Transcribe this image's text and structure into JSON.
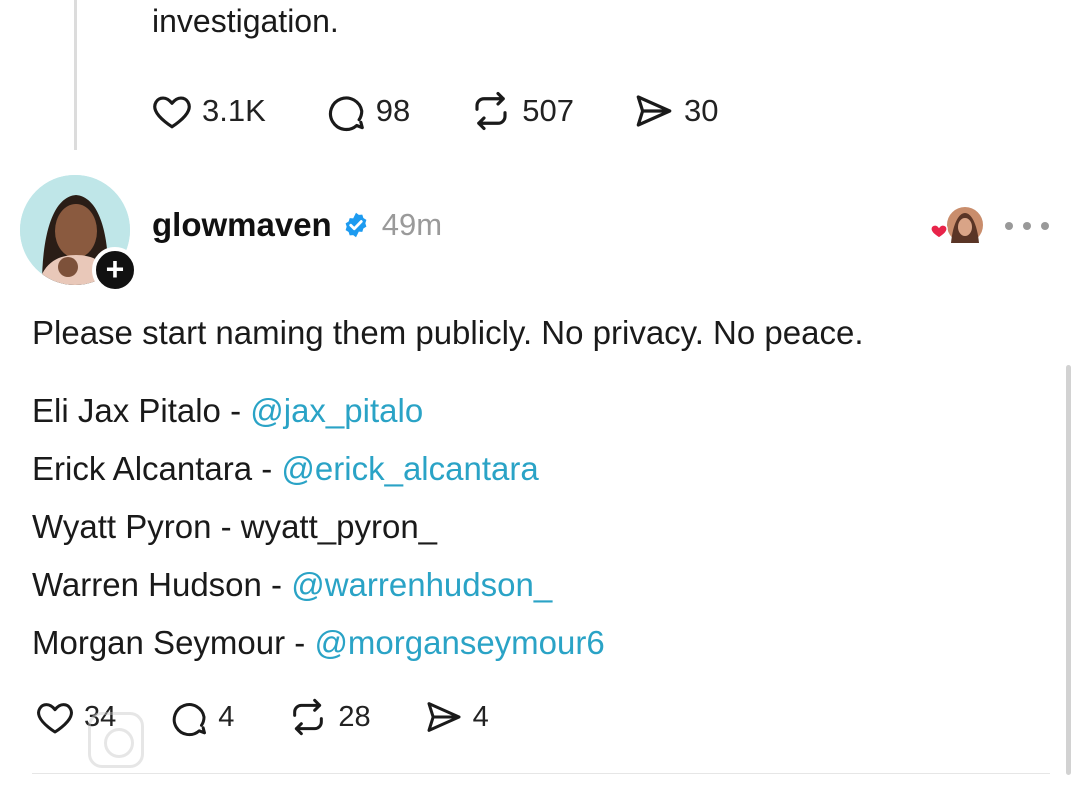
{
  "previous_post": {
    "text_tail": "investigation.",
    "actions": {
      "likes": "3.1K",
      "replies": "98",
      "reposts": "507",
      "shares": "30"
    }
  },
  "post": {
    "username": "glowmaven",
    "timestamp": "49m",
    "text": "Please start naming them publicly. No privacy. No peace.",
    "tags": [
      {
        "name": "Eli Jax Pitalo - ",
        "handle": "@jax_pitalo"
      },
      {
        "name": "Erick Alcantara - ",
        "handle": "@erick_alcantara"
      },
      {
        "name": "Wyatt Pyron - ",
        "handle": "wyatt_pyron_"
      },
      {
        "name": "Warren Hudson - ",
        "handle": "@warrenhudson_"
      },
      {
        "name": "Morgan Seymour - ",
        "handle": "@morganseymour6"
      }
    ],
    "actions": {
      "likes": "34",
      "replies": "4",
      "reposts": "28",
      "shares": "4"
    }
  },
  "colors": {
    "mention": "#2aa3c6",
    "verified": "#1d9bf0",
    "timestamp": "#9a9a9a",
    "heart_badge": "#e8244a"
  },
  "icons": [
    "heart-icon",
    "comment-icon",
    "repost-icon",
    "share-icon",
    "verified-badge-icon",
    "plus-icon",
    "more-icon"
  ]
}
